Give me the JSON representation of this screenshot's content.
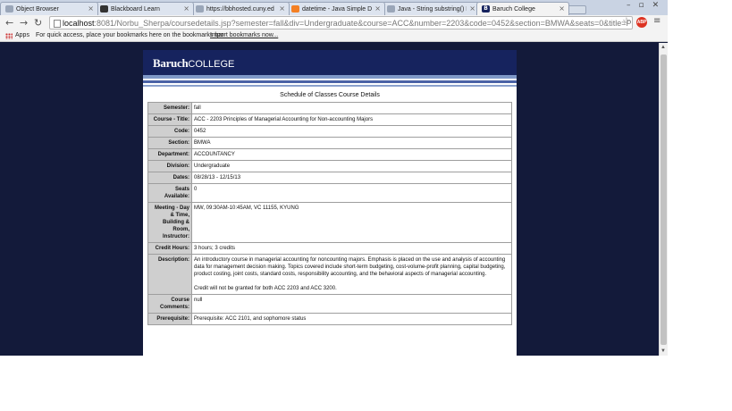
{
  "tabs": [
    {
      "label": "Object Browser",
      "icon": "page-icon",
      "icon_color": "#9aa6b8",
      "icon_text": ""
    },
    {
      "label": "Blackboard Learn",
      "icon": "blackboard-icon",
      "icon_color": "#333333",
      "icon_text": ""
    },
    {
      "label": "https://bbhosted.cuny.ed",
      "icon": "page-icon",
      "icon_color": "#9aa6b8",
      "icon_text": ""
    },
    {
      "label": "datetime - Java Simple Da",
      "icon": "stackoverflow-icon",
      "icon_color": "#f48024",
      "icon_text": ""
    },
    {
      "label": "Java - String substring() M",
      "icon": "page-icon",
      "icon_color": "#9aa6b8",
      "icon_text": ""
    },
    {
      "label": "Baruch College",
      "icon": "baruch-b-icon",
      "icon_color": "#16235e",
      "icon_text": "B"
    }
  ],
  "tab_close_glyph": "×",
  "window_controls": "–▫✕",
  "toolbar": {
    "back": "←",
    "forward": "→",
    "reload": "↻",
    "url_host": "localhost",
    "url_rest": ":8081/Norbu_Sherpa/coursedetails.jsp?semester=fall&div=Undergraduate&course=ACC&number=2203&code=0452&section=BMWA&seats=0&title=Prin",
    "star": "☆",
    "adblock": "ABP",
    "menu": "≡"
  },
  "bookmarks": {
    "apps": "Apps",
    "hint": "For quick access, place your bookmarks here on the bookmarks bar.",
    "import": "Import bookmarks now..."
  },
  "scroll": {
    "up": "▲",
    "down": "▼"
  },
  "page": {
    "logo_bold": "Baruch",
    "logo_light": "COLLEGE",
    "title": "Schedule of Classes Course Details",
    "rows": [
      {
        "label": "Semester:",
        "value": "fall"
      },
      {
        "label": "Course - Title:",
        "value": "ACC - 2203 Principles of Managerial Accounting for Non-accounting Majors"
      },
      {
        "label": "Code:",
        "value": "0452"
      },
      {
        "label": "Section:",
        "value": "BMWA"
      },
      {
        "label": "Department:",
        "value": "ACCOUNTANCY"
      },
      {
        "label": "Division:",
        "value": "Undergraduate"
      },
      {
        "label": "Dates:",
        "value": "08/28/13 - 12/15/13"
      },
      {
        "label": "Seats Available:",
        "value": "0"
      },
      {
        "label": "Meeting - Day & Time, Building & Room, Instructor:",
        "value": "MW, 09:30AM-10:45AM, VC 11155, KYUNG"
      },
      {
        "label": "Credit Hours:",
        "value": "3 hours; 3 credits"
      },
      {
        "label": "Description:",
        "value": "An introductory course in managerial accounting for noncounting majors. Emphasis is placed on the use and analysis of accounting data for management decision making. Topics covered include short-term budgeting, cost-volume-profit planning, capital budgeting, product costing, joint costs, standard costs, responsibility accounting, and the behavioral aspects of managerial accounting.\n\nCredit will not be granted for both ACC 2203 and ACC 3200."
      },
      {
        "label": "Course Comments:",
        "value": "null"
      },
      {
        "label": "Prerequisite:",
        "value": "Prerequisite: ACC 2101, and sophomore status"
      }
    ]
  }
}
